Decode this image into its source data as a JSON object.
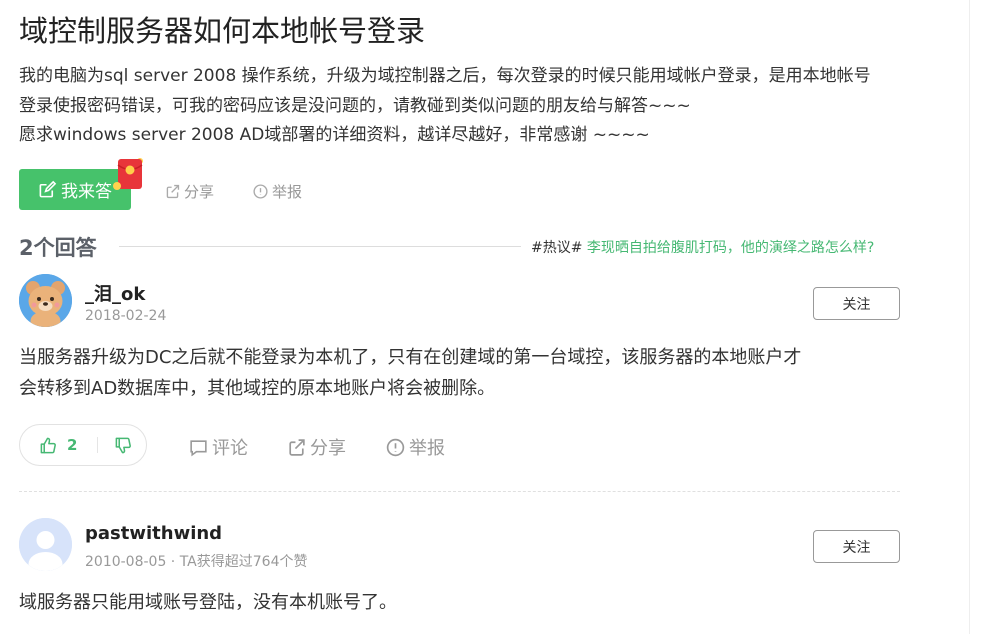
{
  "question": {
    "title": "域控制服务器如何本地帐号登录",
    "body_lines": [
      "我的电脑为sql server 2008 操作系统，升级为域控制器之后，每次登录的时候只能用域帐户登录，是用本地帐号",
      "登录使报密码错误，可我的密码应该是没问题的，请教碰到类似问题的朋友给与解答~~~",
      "愿求windows server 2008 AD域部署的详细资料，越详尽越好，非常感谢 ~~~~"
    ],
    "answer_button": "我来答",
    "red_packet_icon": "red-envelope-icon",
    "share_label": "分享",
    "report_label": "举报"
  },
  "answers_header": {
    "count_label": "2个回答",
    "hot_tag": "#热议#",
    "hot_link": "李现晒自拍给腹肌打码，他的演绎之路怎么样?"
  },
  "answers": [
    {
      "user": "_泪_ok",
      "meta": "2018-02-24",
      "follow_label": "关注",
      "text_lines": [
        "当服务器升级为DC之后就不能登录为本机了，只有在创建域的第一台域控，该服务器的本地账户才",
        "会转移到AD数据库中，其他域控的原本地账户将会被删除。"
      ],
      "likes": "2",
      "comment_label": "评论",
      "share_label": "分享",
      "report_label": "举报"
    },
    {
      "user": "pastwithwind",
      "meta": "2010-08-05 · TA获得超过764个赞",
      "follow_label": "关注",
      "text_lines": [
        "域服务器只能用域账号登陆，没有本机账号了。"
      ]
    }
  ],
  "colors": {
    "accent_green": "#46c26b",
    "link_green": "#46b873",
    "muted": "#999999"
  }
}
